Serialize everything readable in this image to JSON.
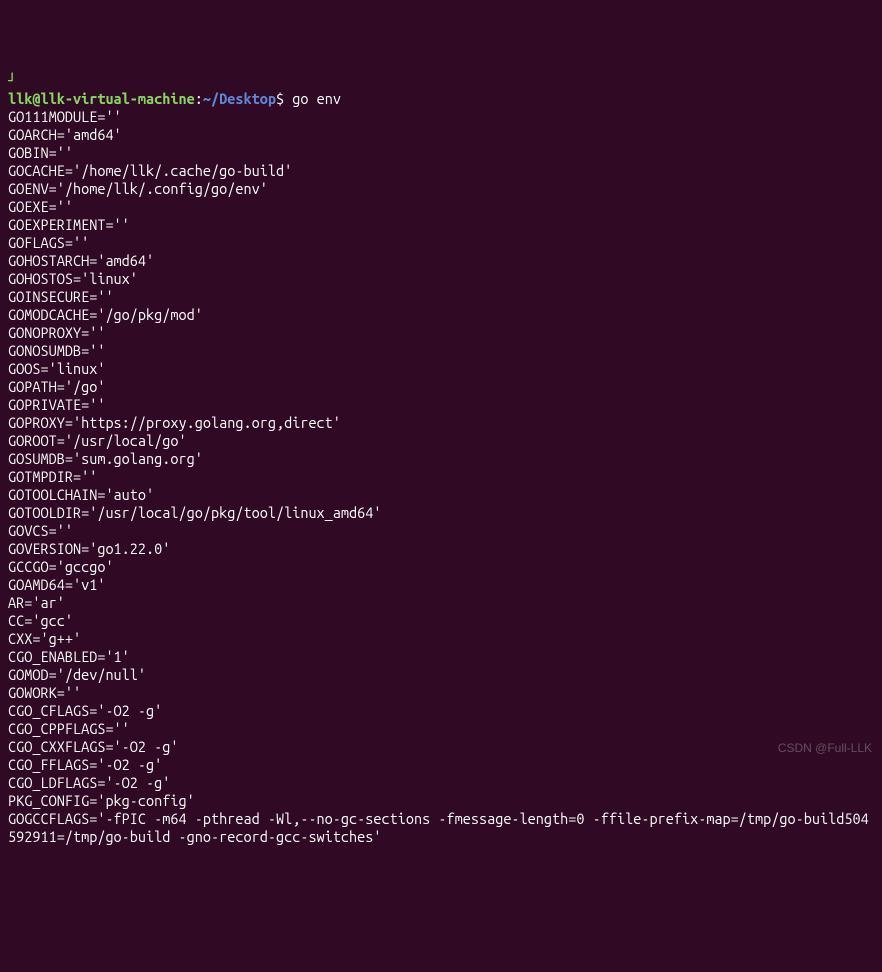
{
  "prompt": {
    "tail_glyph": "┘",
    "user": "llk@llk-virtual-machine",
    "colon": ":",
    "path": "~/Desktop",
    "dollar": "$",
    "command": "go env"
  },
  "env_lines": [
    "GO111MODULE=''",
    "GOARCH='amd64'",
    "GOBIN=''",
    "GOCACHE='/home/llk/.cache/go-build'",
    "GOENV='/home/llk/.config/go/env'",
    "GOEXE=''",
    "GOEXPERIMENT=''",
    "GOFLAGS=''",
    "GOHOSTARCH='amd64'",
    "GOHOSTOS='linux'",
    "GOINSECURE=''",
    "GOMODCACHE='/go/pkg/mod'",
    "GONOPROXY=''",
    "GONOSUMDB=''",
    "GOOS='linux'",
    "GOPATH='/go'",
    "GOPRIVATE=''",
    "GOPROXY='https://proxy.golang.org,direct'",
    "GOROOT='/usr/local/go'",
    "GOSUMDB='sum.golang.org'",
    "GOTMPDIR=''",
    "GOTOOLCHAIN='auto'",
    "GOTOOLDIR='/usr/local/go/pkg/tool/linux_amd64'",
    "GOVCS=''",
    "GOVERSION='go1.22.0'",
    "GCCGO='gccgo'",
    "GOAMD64='v1'",
    "AR='ar'",
    "CC='gcc'",
    "CXX='g++'",
    "CGO_ENABLED='1'",
    "GOMOD='/dev/null'",
    "GOWORK=''",
    "CGO_CFLAGS='-O2 -g'",
    "CGO_CPPFLAGS=''",
    "CGO_CXXFLAGS='-O2 -g'",
    "CGO_FFLAGS='-O2 -g'",
    "CGO_LDFLAGS='-O2 -g'",
    "PKG_CONFIG='pkg-config'",
    "GOGCCFLAGS='-fPIC -m64 -pthread -Wl,--no-gc-sections -fmessage-length=0 -ffile-prefix-map=/tmp/go-build504592911=/tmp/go-build -gno-record-gcc-switches'"
  ],
  "watermark": "CSDN @Full-LLK"
}
